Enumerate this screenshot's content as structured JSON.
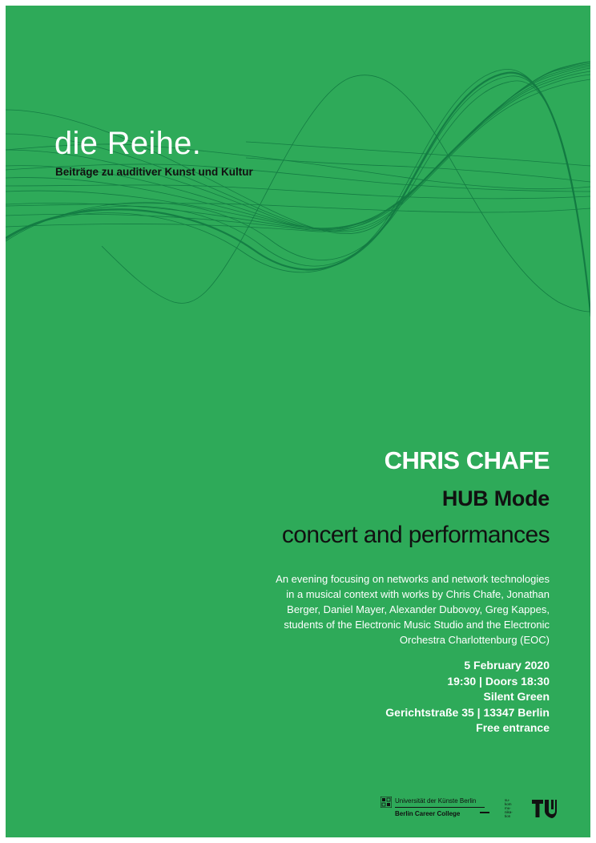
{
  "header": {
    "series_title": "die Reihe.",
    "series_subtitle": "Beiträge zu auditiver Kunst und Kultur"
  },
  "event": {
    "artist": "CHRIS CHAFE",
    "work": "HUB Mode",
    "format": "concert and performances",
    "description_lines": [
      "An evening focusing on networks and network technologies",
      "in a musical context with works by Chris Chafe, Jonathan",
      "Berger, Daniel Mayer, Alexander Dubovoy, Greg Kappes,",
      "students of the Electronic Music Studio and the Electronic",
      "Orchestra Charlottenburg (EOC)"
    ],
    "date": "5 February 2020",
    "time": "19:30 | Doors 18:30",
    "venue": "Silent Green",
    "address": "Gerichtstraße 35 | 13347 Berlin",
    "admission": "Free entrance"
  },
  "footer": {
    "udk_name": "Universität der Künste Berlin",
    "bcc_name": "Berlin Career College",
    "sukom_lines": [
      "su-",
      "kom",
      "mu-",
      "nika-",
      "tion"
    ]
  },
  "colors": {
    "background": "#2eaa59",
    "wave": "#137a42",
    "accent_text": "#ffffff",
    "dark_text": "#111111"
  },
  "icons": [
    "udk-logo-icon",
    "sukom-logo-icon",
    "tu-logo-icon"
  ]
}
